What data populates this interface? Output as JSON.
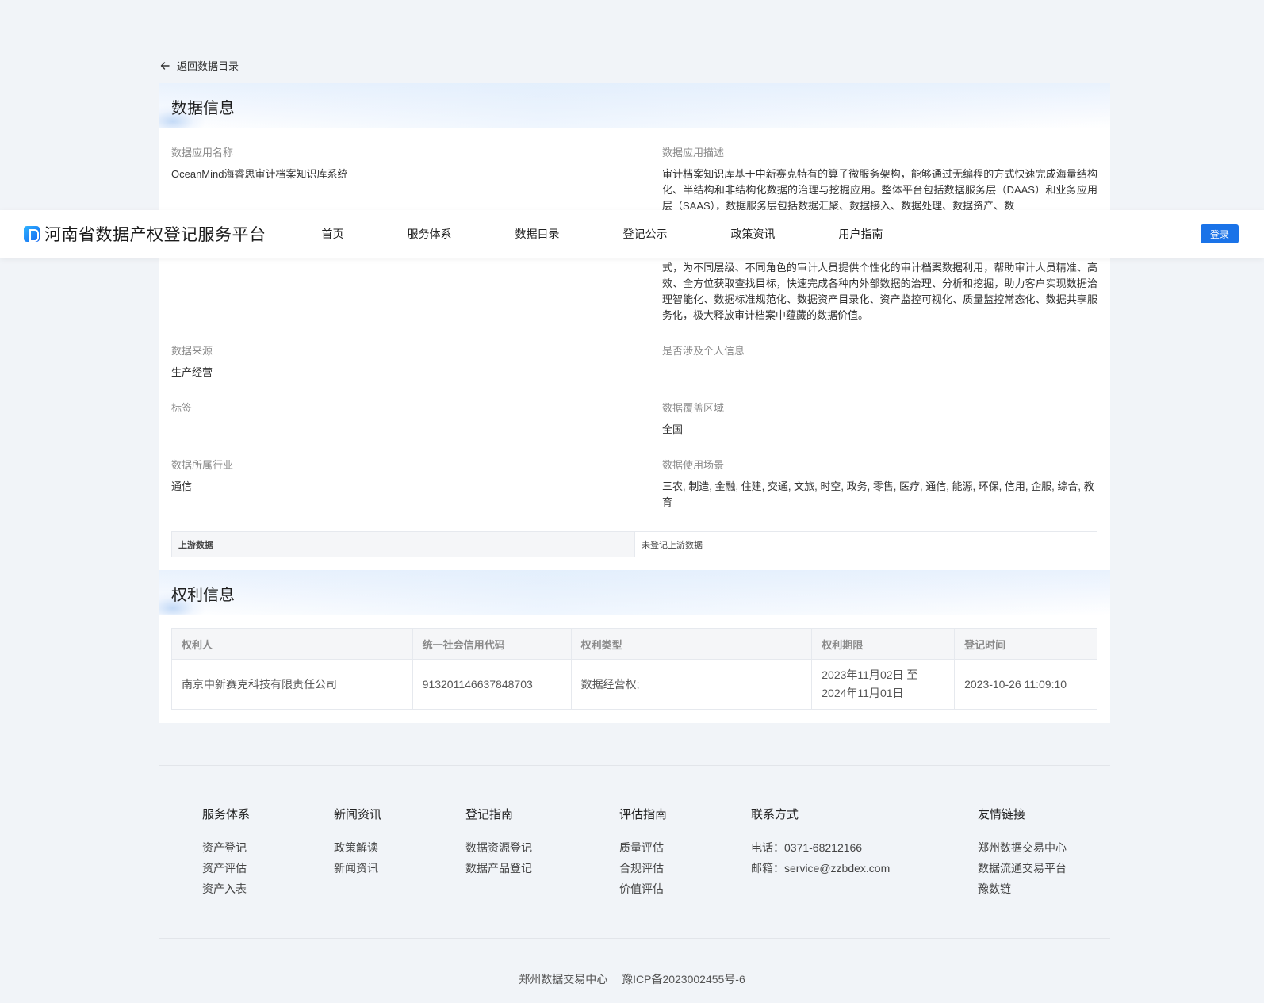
{
  "back": {
    "label": "返回数据目录"
  },
  "data_section": {
    "title": "数据信息",
    "fields": {
      "app_name": {
        "label": "数据应用名称",
        "value": "OceanMind海睿思审计档案知识库系统"
      },
      "app_desc": {
        "label": "数据应用描述",
        "value_top": "审计档案知识库基于中新赛克特有的算子微服务架构，能够通过无编程的方式快速完成海量结构化、半结构和非结构化数据的治理与挖掘应用。整体平台包括数据服务层（DAAS）和业务应用层（SAAS），数据服务层包括数据汇聚、数据接入、数据处理、数据资产、数",
        "value_bottom": "式，为不同层级、不同角色的审计人员提供个性化的审计档案数据利用，帮助审计人员精准、高效、全方位获取查找目标，快速完成各种内外部数据的治理、分析和挖掘，助力客户实现数据治理智能化、数据标准规范化、数据资产目录化、资产监控可视化、质量监控常态化、数据共享服务化，极大释放审计档案中蕴藏的数据价值。"
      },
      "source": {
        "label": "数据来源",
        "value": "生产经营"
      },
      "personal_info": {
        "label": "是否涉及个人信息",
        "value": ""
      },
      "tags": {
        "label": "标签",
        "value": ""
      },
      "coverage": {
        "label": "数据覆盖区域",
        "value": "全国"
      },
      "industry": {
        "label": "数据所属行业",
        "value": "通信"
      },
      "scenarios": {
        "label": "数据使用场景",
        "value": "三农, 制造, 金融, 住建, 交通, 文旅, 时空, 政务, 零售, 医疗, 通信, 能源, 环保, 信用, 企服, 综合, 教育"
      }
    },
    "upstream": {
      "label": "上游数据",
      "value": "未登记上游数据"
    }
  },
  "rights_section": {
    "title": "权利信息",
    "columns": [
      "权利人",
      "统一社会信用代码",
      "权利类型",
      "权利期限",
      "登记时间"
    ],
    "rows": [
      {
        "holder": "南京中新赛克科技有限责任公司",
        "credit_code": "913201146637848703",
        "right_type": "数据经营权;",
        "period_line1": "2023年11月02日 至",
        "period_line2": "2024年11月01日",
        "reg_time": "2023-10-26 11:09:10"
      }
    ]
  },
  "nav": {
    "brand": "河南省数据产权登记服务平台",
    "items": [
      "首页",
      "服务体系",
      "数据目录",
      "登记公示",
      "政策资讯",
      "用户指南"
    ],
    "login": "登录"
  },
  "footer": {
    "columns": [
      {
        "title": "服务体系",
        "links": [
          "资产登记",
          "资产评估",
          "资产入表"
        ]
      },
      {
        "title": "新闻资讯",
        "links": [
          "政策解读",
          "新闻资讯"
        ]
      },
      {
        "title": "登记指南",
        "links": [
          "数据资源登记",
          "数据产品登记"
        ]
      },
      {
        "title": "评估指南",
        "links": [
          "质量评估",
          "合规评估",
          "价值评估"
        ]
      },
      {
        "title": "联系方式",
        "links": [
          "电话：0371-68212166",
          "邮箱：service@zzbdex.com"
        ]
      },
      {
        "title": "友情链接",
        "links": [
          "郑州数据交易中心",
          "数据流通交易平台",
          "豫数链"
        ]
      }
    ],
    "copyright_org": "郑州数据交易中心",
    "icp": "豫ICP备2023002455号-6"
  },
  "colors": {
    "primary": "#1a73e8",
    "page_bg": "#f1f4f8"
  }
}
